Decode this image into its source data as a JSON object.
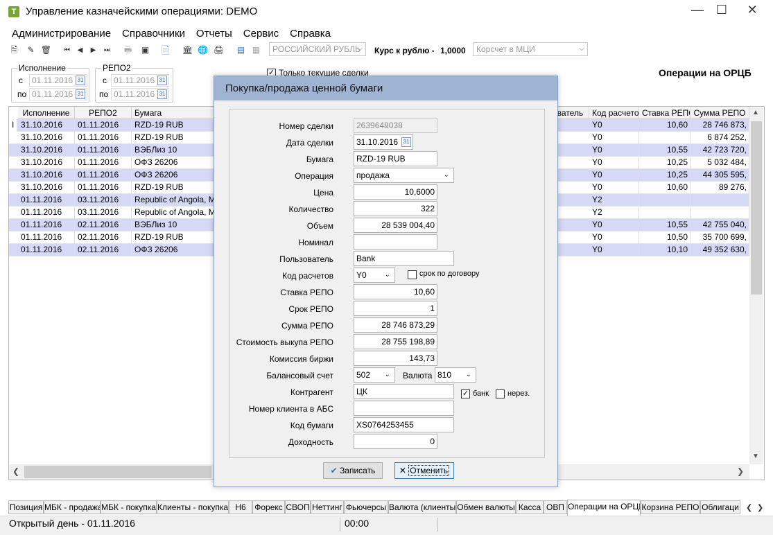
{
  "window": {
    "title": "Управление казначейскими операциями: DEMO",
    "app_icon": "T"
  },
  "menu": [
    "Администрирование",
    "Справочники",
    "Отчеты",
    "Сервис",
    "Справка"
  ],
  "toolbar": {
    "currency": "РОССИЙСКИЙ РУБЛЬ",
    "rate_label": "Курс к рублю -",
    "rate_value": "1,0000",
    "account": "Корсчет в МЦИ"
  },
  "filters": {
    "exec_label": "Исполнение",
    "repo_label": "РЕПО2",
    "from": "с",
    "to": "по",
    "exec_from": "01.11.2016",
    "exec_to": "01.11.2016",
    "repo_from": "01.11.2016",
    "repo_to": "01.11.2016",
    "only_current": "Только текущие сделки",
    "page_title": "Операции на ОРЦБ"
  },
  "grid": {
    "headers_left": [
      "Исполнение",
      "РЕПО2",
      "Бумага"
    ],
    "headers_right": [
      "ователь",
      "Код расчетов",
      "Ставка РЕПО",
      "Сумма РЕПО"
    ],
    "cursor": "I",
    "rows": [
      {
        "exec": "31.10.2016",
        "repo": "01.11.2016",
        "paper": "RZD-19 RUB",
        "code": "Y0",
        "rate": "10,60",
        "sum": "28 746 873,"
      },
      {
        "exec": "31.10.2016",
        "repo": "01.11.2016",
        "paper": "RZD-19 RUB",
        "code": "Y0",
        "rate": "",
        "sum": "6 874 252,"
      },
      {
        "exec": "31.10.2016",
        "repo": "01.11.2016",
        "paper": "ВЭБЛиз 10",
        "code": "Y0",
        "rate": "10,55",
        "sum": "42 723 720,"
      },
      {
        "exec": "31.10.2016",
        "repo": "01.11.2016",
        "paper": "ОФЗ 26206",
        "code": "Y0",
        "rate": "10,25",
        "sum": "5 032 484,"
      },
      {
        "exec": "31.10.2016",
        "repo": "01.11.2016",
        "paper": "ОФЗ 26206",
        "code": "Y0",
        "rate": "10,25",
        "sum": "44 305 595,"
      },
      {
        "exec": "31.10.2016",
        "repo": "01.11.2016",
        "paper": "RZD-19 RUB",
        "code": "Y0",
        "rate": "10,60",
        "sum": "89 276,"
      },
      {
        "exec": "01.11.2016",
        "repo": "03.11.2016",
        "paper": "Republic of Angola, Minis",
        "code": "Y2",
        "rate": "",
        "sum": ""
      },
      {
        "exec": "01.11.2016",
        "repo": "03.11.2016",
        "paper": "Republic of Angola, Minis",
        "code": "Y2",
        "rate": "",
        "sum": ""
      },
      {
        "exec": "01.11.2016",
        "repo": "02.11.2016",
        "paper": "ВЭБЛиз 10",
        "code": "Y0",
        "rate": "10,55",
        "sum": "42 755 040,"
      },
      {
        "exec": "01.11.2016",
        "repo": "02.11.2016",
        "paper": "RZD-19 RUB",
        "code": "Y0",
        "rate": "10,50",
        "sum": "35 700 699,"
      },
      {
        "exec": "01.11.2016",
        "repo": "02.11.2016",
        "paper": "ОФЗ 26206",
        "code": "Y0",
        "rate": "10,10",
        "sum": "49 352 630,"
      }
    ]
  },
  "tabs": [
    "Позиция",
    "МБК - продажа",
    "МБК - покупка",
    "Клиенты - покупка",
    "Н6",
    "Форекс",
    "СВОП",
    "Неттинг",
    "Фьючерсы",
    "Валюта (клиенты)",
    "Обмен валюты",
    "Касса",
    "ОВП",
    "Операции на ОРЦБ",
    "Корзина РЕПО",
    "Облигаци"
  ],
  "active_tab": "Операции на ОРЦБ",
  "status": {
    "day": "Открытый день - 01.11.2016",
    "time": "00:00"
  },
  "dialog": {
    "title": "Покупка/продажа ценной бумаги",
    "labels": {
      "deal_no": "Номер сделки",
      "deal_date": "Дата сделки",
      "paper": "Бумага",
      "operation": "Операция",
      "price": "Цена",
      "quantity": "Количество",
      "volume": "Объем",
      "nominal": "Номинал",
      "user": "Пользователь",
      "settle_code": "Код расчетов",
      "contract_term": "срок по договору",
      "repo_rate": "Ставка РЕПО",
      "repo_term": "Срок РЕПО",
      "repo_sum": "Сумма РЕПО",
      "repo_buyback": "Стоимость выкупа РЕПО",
      "commission": "Комиссия биржи",
      "balance_acc": "Балансовый счет",
      "currency": "Валюта",
      "counterparty": "Контрагент",
      "bank": "банк",
      "nonres": "нерез.",
      "client_abs": "Номер клиента в АБС",
      "paper_code": "Код бумаги",
      "yield": "Доходность"
    },
    "values": {
      "deal_no": "2639648038",
      "deal_date": "31.10.2016",
      "paper": "RZD-19 RUB",
      "operation": "продажа",
      "price": "10,6000",
      "quantity": "322",
      "volume": "28 539 004,40",
      "nominal": "",
      "user": "Bank",
      "settle_code": "Y0",
      "repo_rate": "10,60",
      "repo_term": "1",
      "repo_sum": "28 746 873,29",
      "repo_buyback": "28 755 198,89",
      "commission": "143,73",
      "balance_acc": "502",
      "currency": "810",
      "counterparty": "ЦК",
      "client_abs": "",
      "paper_code": "XS0764253455",
      "yield": "0"
    },
    "bank_checked": true,
    "nonres_checked": false,
    "contract_term_checked": false,
    "buttons": {
      "save": "Записать",
      "cancel": "Отменить"
    }
  }
}
